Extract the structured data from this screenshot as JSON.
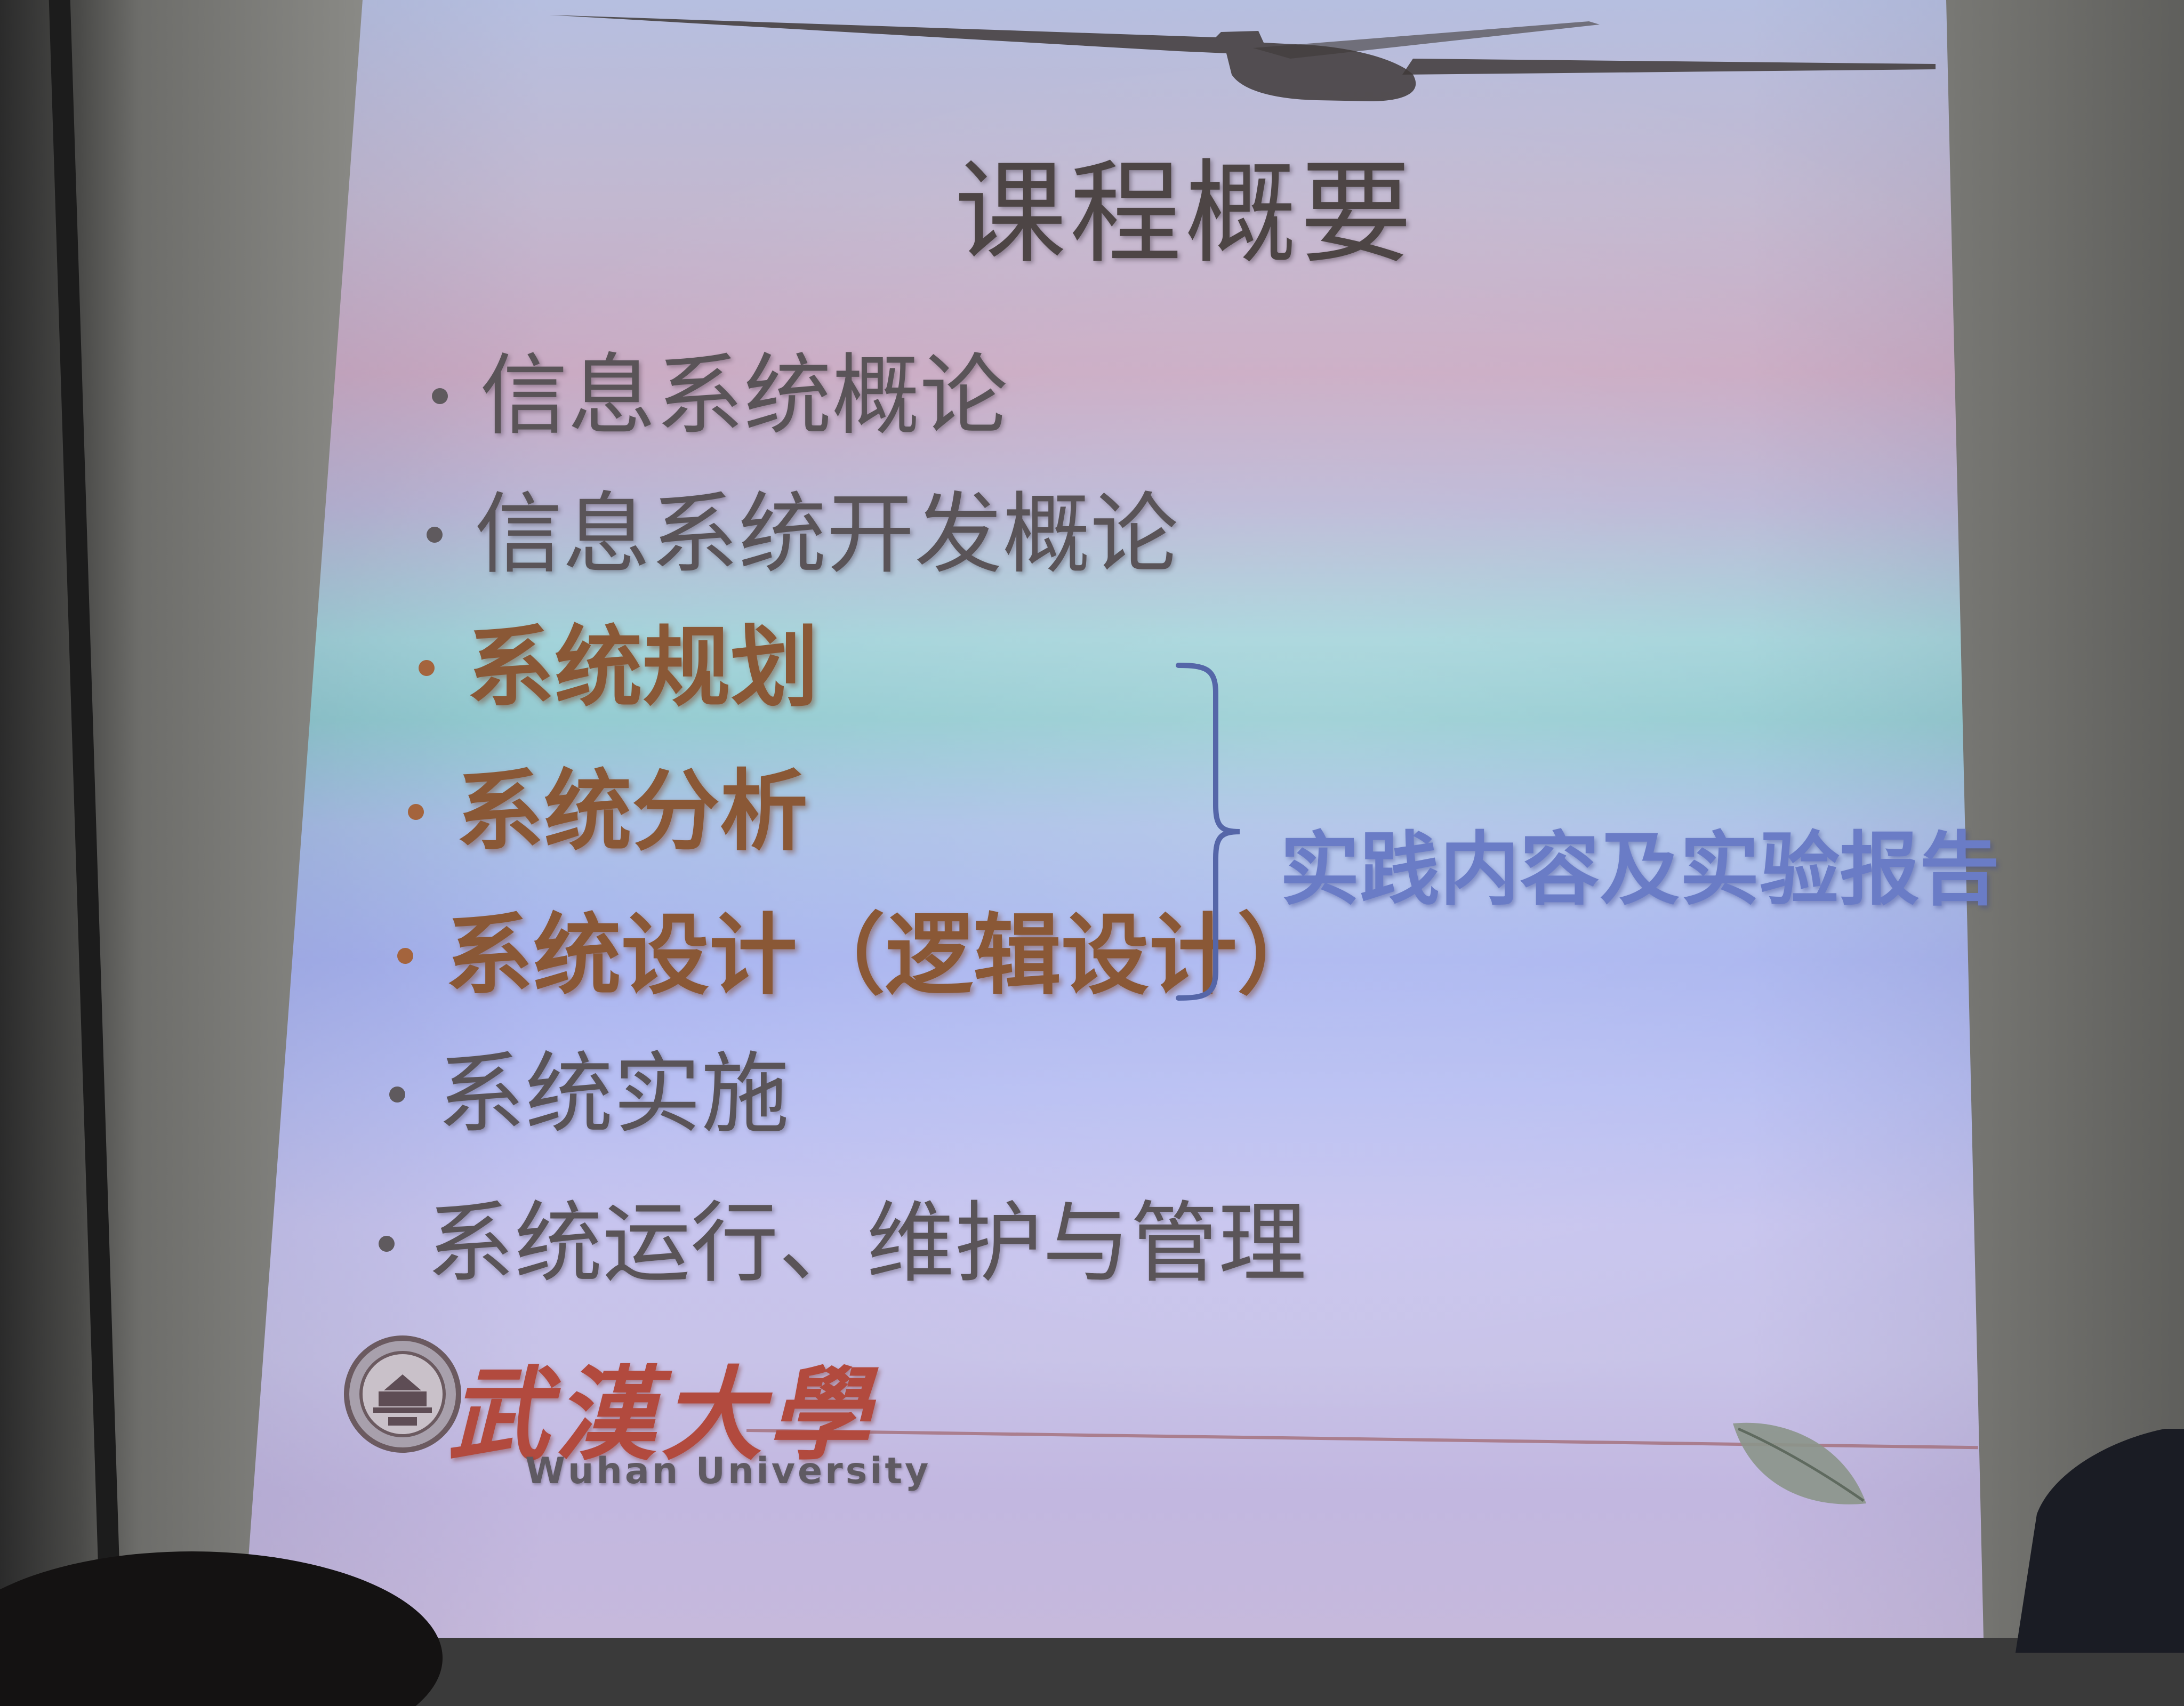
{
  "slide": {
    "title": "课程概要",
    "bullets": [
      {
        "text": "信息系统概论",
        "highlighted": false
      },
      {
        "text": "信息系统开发概论",
        "highlighted": false
      },
      {
        "text": "系统规划",
        "highlighted": true
      },
      {
        "text": "系统分析",
        "highlighted": true
      },
      {
        "text": "系统设计（逻辑设计）",
        "highlighted": true
      },
      {
        "text": "系统实施",
        "highlighted": false
      },
      {
        "text": "系统运行、维护与管理",
        "highlighted": false
      }
    ],
    "brace_label": "实践内容及实验报告",
    "footer": {
      "university_cn": "武漢大學",
      "university_en": "Wuhan University"
    },
    "colors": {
      "title": "#4d4545",
      "plain_bullet": "#5a5458",
      "highlight_bullet": "#8a5836",
      "brace_label": "#6a7cc6",
      "university_cn": "#b24a3e"
    }
  }
}
